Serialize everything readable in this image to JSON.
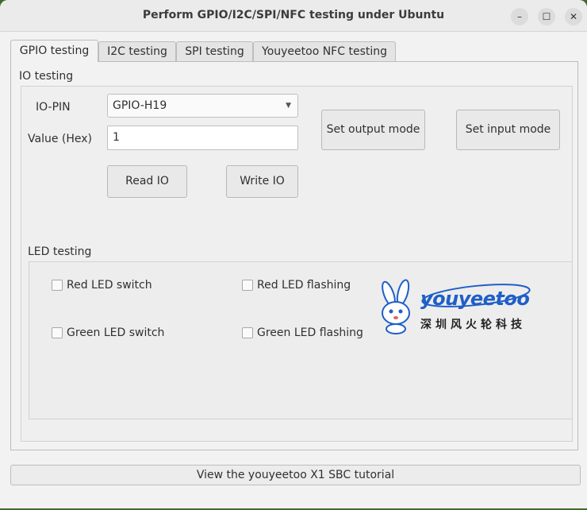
{
  "window": {
    "title": "Perform GPIO/I2C/SPI/NFC testing under Ubuntu",
    "controls": {
      "minimize": "–",
      "maximize": "☐",
      "close": "✕"
    }
  },
  "tabs": [
    {
      "label": "GPIO testing",
      "active": true
    },
    {
      "label": "I2C testing",
      "active": false
    },
    {
      "label": "SPI testing",
      "active": false
    },
    {
      "label": "Youyeetoo NFC testing",
      "active": false
    }
  ],
  "io": {
    "section_title": "IO testing",
    "pin_label": "IO-PIN",
    "pin_value": "GPIO-H19",
    "value_label": "Value (Hex)",
    "value": "1",
    "read_button": "Read IO",
    "write_button": "Write IO",
    "output_button": "Set output mode",
    "input_button": "Set input mode"
  },
  "led": {
    "section_title": "LED testing",
    "red_switch": "Red LED switch",
    "red_flashing": "Red LED flashing",
    "green_switch": "Green LED switch",
    "green_flashing": "Green LED flashing"
  },
  "logo": {
    "word": "youyeetoo",
    "chinese": "深圳风火轮科技"
  },
  "footer": {
    "tutorial_button": "View the youyeetoo X1 SBC tutorial"
  },
  "colors": {
    "brand_blue": "#1f5fc7",
    "window_bg": "#f2f2f2",
    "desktop_bg": "#3f6b2d"
  },
  "icons": {
    "dropdown": "chevron-down-icon",
    "mascot": "rabbit-mascot-icon"
  }
}
